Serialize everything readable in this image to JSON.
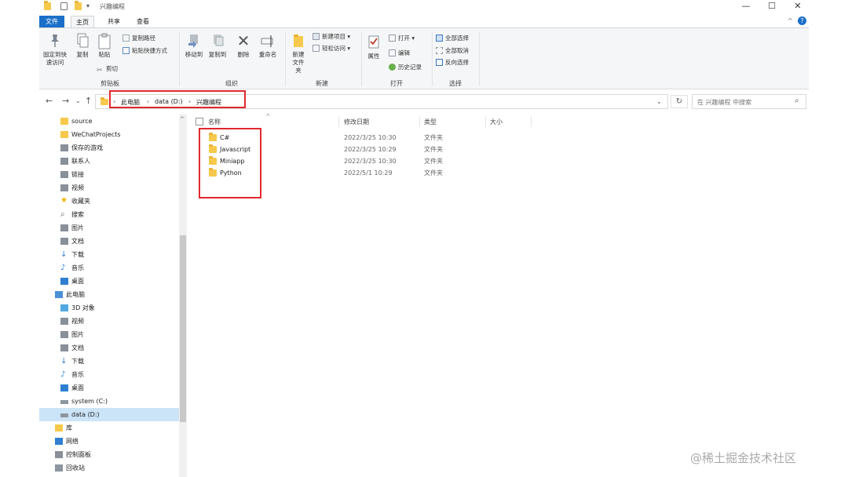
{
  "window": {
    "title": "兴趣编程",
    "controls": {
      "minimize": "—",
      "maximize": "☐",
      "close": "✕"
    }
  },
  "ribbon_tabs": [
    "文件",
    "主页",
    "共享",
    "查看"
  ],
  "ribbon": {
    "clipboard": {
      "pin_label": "固定到快速访问",
      "copy_label": "复制",
      "paste_label": "粘贴",
      "copy_path_label": "复制路径",
      "paste_shortcut_label": "粘贴快捷方式",
      "cut_label": "剪切",
      "group_label": "剪贴板"
    },
    "organize": {
      "move_to_label": "移动到",
      "copy_to_label": "复制到",
      "delete_label": "删除",
      "rename_label": "重命名",
      "group_label": "组织"
    },
    "new": {
      "new_folder_label": "新建文件夹",
      "new_item_label": "新建项目",
      "easy_access_label": "轻松访问",
      "group_label": "新建"
    },
    "open": {
      "properties_label": "属性",
      "open_label": "打开",
      "edit_label": "编辑",
      "history_label": "历史记录",
      "group_label": "打开"
    },
    "select": {
      "select_all_label": "全部选择",
      "select_none_label": "全部取消",
      "invert_label": "反向选择",
      "group_label": "选择"
    }
  },
  "address": {
    "crumbs": [
      "此电脑",
      "data (D:)",
      "兴趣编程"
    ],
    "search_placeholder": "在 兴趣编程 中搜索"
  },
  "nav_items": [
    {
      "label": "source",
      "icon": "folder-icon"
    },
    {
      "label": "WeChatProjects",
      "icon": "folder-icon"
    },
    {
      "label": "保存的游戏",
      "icon": "saved-games-icon"
    },
    {
      "label": "联系人",
      "icon": "contacts-icon"
    },
    {
      "label": "链接",
      "icon": "link-icon"
    },
    {
      "label": "视频",
      "icon": "video-icon"
    },
    {
      "label": "收藏夹",
      "icon": "star-icon"
    },
    {
      "label": "搜索",
      "icon": "search-icon"
    },
    {
      "label": "图片",
      "icon": "pictures-icon"
    },
    {
      "label": "文档",
      "icon": "documents-icon"
    },
    {
      "label": "下载",
      "icon": "download-icon"
    },
    {
      "label": "音乐",
      "icon": "music-icon"
    },
    {
      "label": "桌面",
      "icon": "desktop-icon"
    },
    {
      "label": "此电脑",
      "icon": "computer-icon"
    },
    {
      "label": "3D 对象",
      "icon": "cube-icon"
    },
    {
      "label": "视频",
      "icon": "video-icon"
    },
    {
      "label": "图片",
      "icon": "pictures-icon"
    },
    {
      "label": "文档",
      "icon": "documents-icon"
    },
    {
      "label": "下载",
      "icon": "download-icon"
    },
    {
      "label": "音乐",
      "icon": "music-icon"
    },
    {
      "label": "桌面",
      "icon": "desktop-icon"
    },
    {
      "label": "system (C:)",
      "icon": "drive-icon"
    },
    {
      "label": "data (D:)",
      "icon": "drive-icon"
    },
    {
      "label": "库",
      "icon": "library-icon"
    },
    {
      "label": "网络",
      "icon": "network-icon"
    },
    {
      "label": "控制面板",
      "icon": "control-panel-icon"
    },
    {
      "label": "回收站",
      "icon": "recycle-bin-icon"
    }
  ],
  "columns": {
    "name": "名称",
    "date": "修改日期",
    "type": "类型",
    "size": "大小"
  },
  "files": [
    {
      "name": "C#",
      "date": "2022/3/25 10:30",
      "type": "文件夹"
    },
    {
      "name": "Javascript",
      "date": "2022/3/25 10:29",
      "type": "文件夹"
    },
    {
      "name": "Miniapp",
      "date": "2022/3/25 10:30",
      "type": "文件夹"
    },
    {
      "name": "Python",
      "date": "2022/5/1 10:29",
      "type": "文件夹"
    }
  ],
  "watermark": "@稀土掘金技术社区",
  "colors": {
    "accent": "#1a6fc9",
    "folder": "#f6c94c",
    "highlight": "#e0282e",
    "selected": "#cce4f7"
  }
}
